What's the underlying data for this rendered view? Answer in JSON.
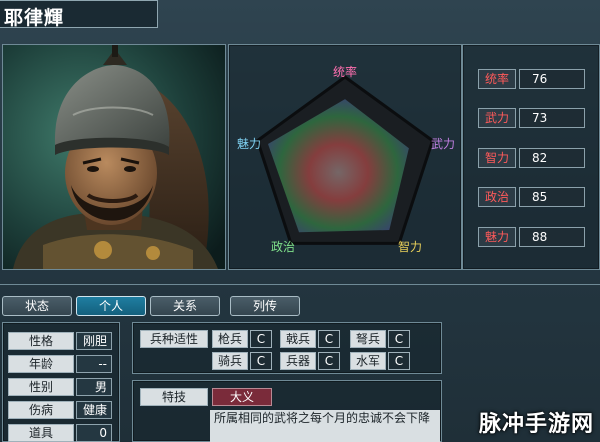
{
  "character": {
    "name": "耶律輝"
  },
  "radar": {
    "labels": [
      "统率",
      "武力",
      "智力",
      "政治",
      "魅力"
    ],
    "values": [
      76,
      73,
      82,
      85,
      88
    ],
    "max": 100
  },
  "stats": [
    {
      "label": "统率",
      "value": "76"
    },
    {
      "label": "武力",
      "value": "73"
    },
    {
      "label": "智力",
      "value": "82"
    },
    {
      "label": "政治",
      "value": "85"
    },
    {
      "label": "魅力",
      "value": "88"
    }
  ],
  "tabs": [
    {
      "label": "状态",
      "active": false
    },
    {
      "label": "个人",
      "active": true
    },
    {
      "label": "关系",
      "active": false
    },
    {
      "label": "列传",
      "active": false
    }
  ],
  "personal": [
    {
      "label": "性格",
      "value": "刚胆"
    },
    {
      "label": "年龄",
      "value": "--"
    },
    {
      "label": "性别",
      "value": "男"
    },
    {
      "label": "伤病",
      "value": "健康"
    },
    {
      "label": "道具",
      "value": "0"
    }
  ],
  "aptitude": {
    "header": "兵种适性",
    "rows": [
      [
        {
          "name": "枪兵",
          "grade": "C"
        },
        {
          "name": "戟兵",
          "grade": "C"
        },
        {
          "name": "弩兵",
          "grade": "C"
        }
      ],
      [
        {
          "name": "骑兵",
          "grade": "C"
        },
        {
          "name": "兵器",
          "grade": "C"
        },
        {
          "name": "水军",
          "grade": "C"
        }
      ]
    ]
  },
  "skill": {
    "label": "特技",
    "name": "大义",
    "description": "所属相同的武将之每个月的忠诚不会下降"
  },
  "watermark": "脉冲手游网",
  "colors": {
    "stat_label": "#ff5a5a",
    "active_tab": "#1f7ea1",
    "skill_name_bg": "#7a2b3a"
  }
}
